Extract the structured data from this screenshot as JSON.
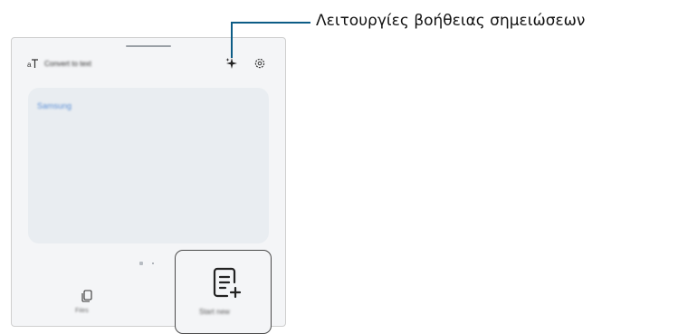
{
  "header": {
    "title": "Convert to text"
  },
  "card": {
    "text": "Samsung"
  },
  "tabs": {
    "files_label": "Files",
    "new_note_label": "Start new"
  },
  "callout": {
    "label": "Λειτουργίες βοήθειας σημειώσεων"
  },
  "icons": {
    "header_left": "text-size-icon",
    "ai": "sparkle-ai-icon",
    "settings": "gear-icon",
    "files": "copy-icon",
    "new_note": "new-note-icon"
  },
  "colors": {
    "callout_line": "#0c5c86",
    "card_bg": "#e9edf1",
    "panel_bg": "#f4f5f7",
    "card_text": "#5b8fd6"
  }
}
